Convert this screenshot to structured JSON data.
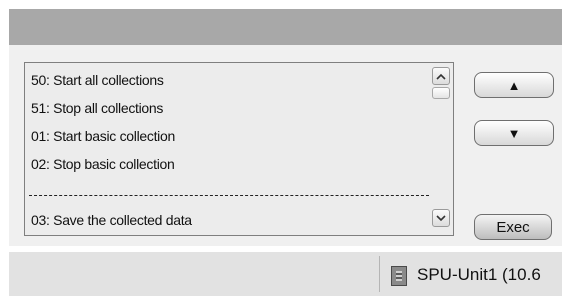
{
  "commands": {
    "items": [
      "50: Start all collections",
      "51: Stop all collections",
      "01: Start basic collection",
      "02: Stop basic collection",
      "03: Save the collected data"
    ]
  },
  "buttons": {
    "up_label": "▲",
    "down_label": "▼",
    "exec_label": "Exec"
  },
  "status": {
    "unit_label": "SPU-Unit1 (10.6"
  }
}
